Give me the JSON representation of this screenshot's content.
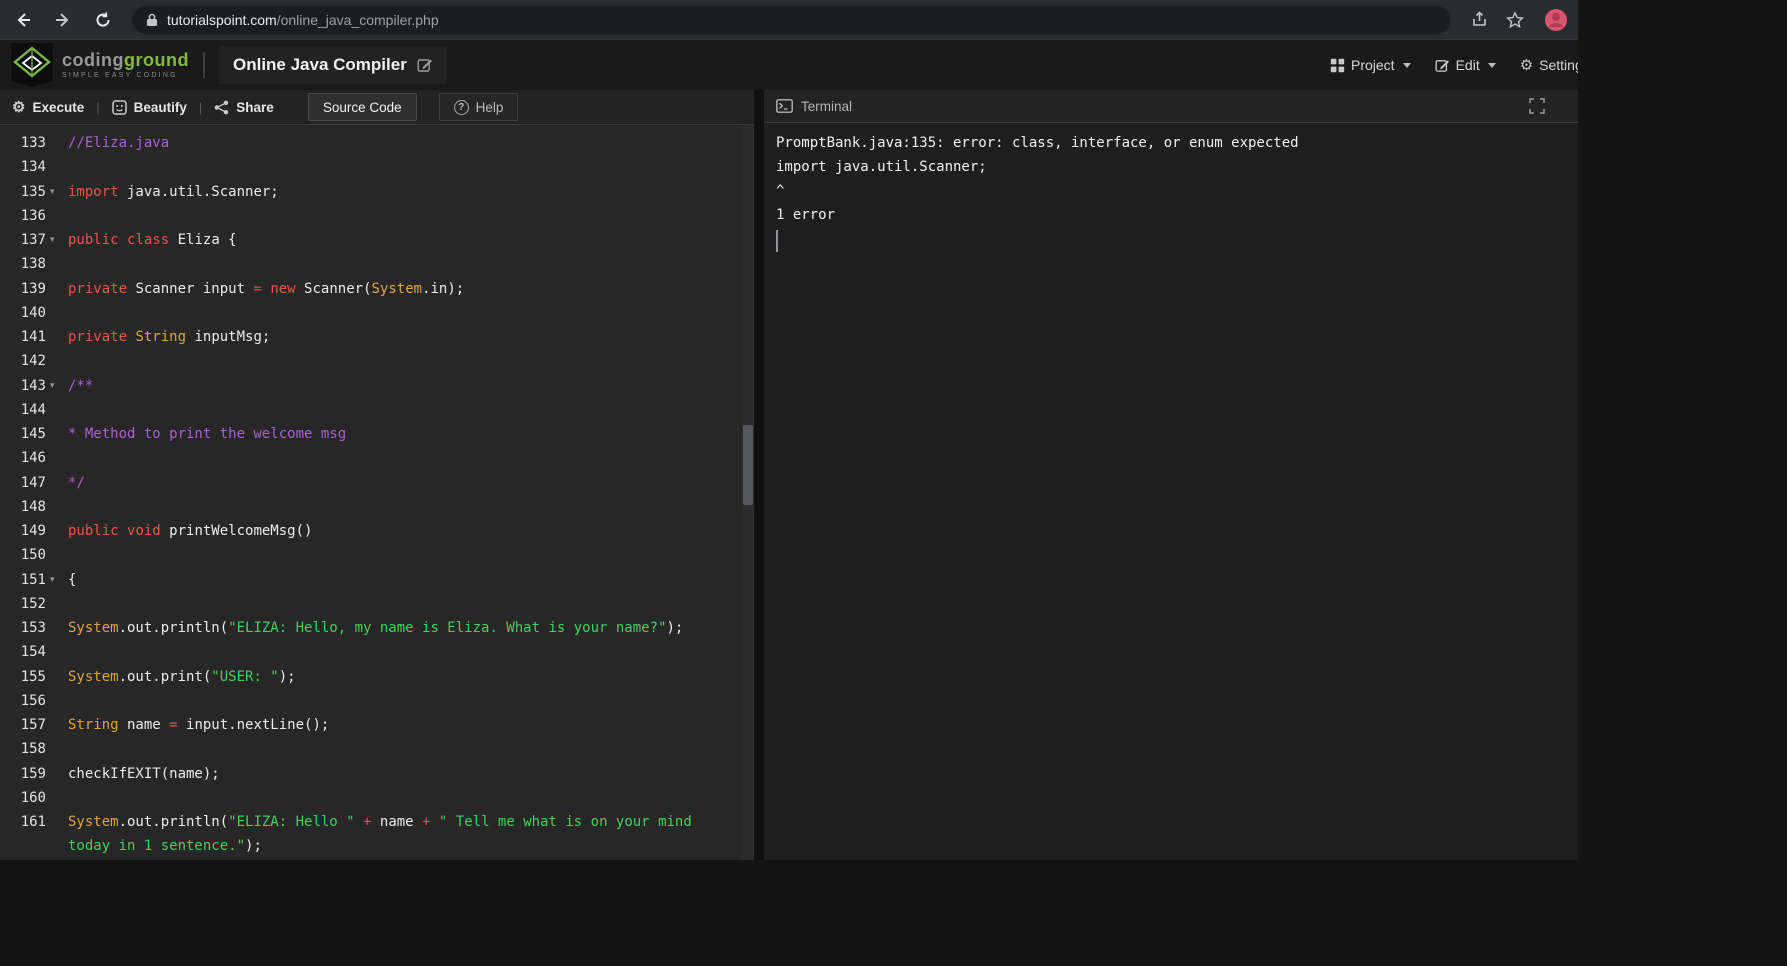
{
  "browser": {
    "url_host": "tutorialspoint.com",
    "url_path": "/online_java_compiler.php"
  },
  "header": {
    "brand_part1": "coding",
    "brand_part2": "ground",
    "tagline": "SIMPLE EASY CODING",
    "title": "Online Java Compiler",
    "menus": {
      "project": "Project",
      "edit": "Edit",
      "settings": "Settings"
    }
  },
  "toolbar": {
    "execute": "Execute",
    "beautify": "Beautify",
    "share": "Share",
    "divider": "|",
    "tabs": {
      "source": "Source Code",
      "help": "Help"
    }
  },
  "icons": {
    "gear": "⚙",
    "help": "?",
    "fold_caret": "▾"
  },
  "editor": {
    "lines": [
      {
        "n": "133",
        "fold": false,
        "seg": [
          [
            "c",
            "//Eliza.java"
          ]
        ]
      },
      {
        "n": "134",
        "fold": false,
        "seg": []
      },
      {
        "n": "135",
        "fold": true,
        "seg": [
          [
            "k",
            "import"
          ],
          [
            "p",
            " java.util.Scanner;"
          ]
        ]
      },
      {
        "n": "136",
        "fold": false,
        "seg": []
      },
      {
        "n": "137",
        "fold": true,
        "seg": [
          [
            "k",
            "public"
          ],
          [
            "p",
            " "
          ],
          [
            "k",
            "class"
          ],
          [
            "p",
            " Eliza {"
          ]
        ]
      },
      {
        "n": "138",
        "fold": false,
        "seg": []
      },
      {
        "n": "139",
        "fold": false,
        "seg": [
          [
            "k",
            "private"
          ],
          [
            "p",
            " Scanner input "
          ],
          [
            "o",
            "="
          ],
          [
            "p",
            " "
          ],
          [
            "k",
            "new"
          ],
          [
            "p",
            " Scanner("
          ],
          [
            "t",
            "System"
          ],
          [
            "p",
            ".in);"
          ]
        ]
      },
      {
        "n": "140",
        "fold": false,
        "seg": []
      },
      {
        "n": "141",
        "fold": false,
        "seg": [
          [
            "k",
            "private"
          ],
          [
            "p",
            " "
          ],
          [
            "t",
            "String"
          ],
          [
            "p",
            " inputMsg;"
          ]
        ]
      },
      {
        "n": "142",
        "fold": false,
        "seg": []
      },
      {
        "n": "143",
        "fold": true,
        "seg": [
          [
            "c",
            "/**"
          ]
        ]
      },
      {
        "n": "144",
        "fold": false,
        "seg": []
      },
      {
        "n": "145",
        "fold": false,
        "seg": [
          [
            "c",
            "* Method to print the welcome msg"
          ]
        ]
      },
      {
        "n": "146",
        "fold": false,
        "seg": []
      },
      {
        "n": "147",
        "fold": false,
        "seg": [
          [
            "c",
            "*/"
          ]
        ]
      },
      {
        "n": "148",
        "fold": false,
        "seg": []
      },
      {
        "n": "149",
        "fold": false,
        "seg": [
          [
            "k",
            "public"
          ],
          [
            "p",
            " "
          ],
          [
            "k",
            "void"
          ],
          [
            "p",
            " printWelcomeMsg()"
          ]
        ]
      },
      {
        "n": "150",
        "fold": false,
        "seg": []
      },
      {
        "n": "151",
        "fold": true,
        "seg": [
          [
            "p",
            "{"
          ]
        ]
      },
      {
        "n": "152",
        "fold": false,
        "seg": []
      },
      {
        "n": "153",
        "fold": false,
        "seg": [
          [
            "t",
            "System"
          ],
          [
            "p",
            ".out.println("
          ],
          [
            "s",
            "\"ELIZA: Hello, my name is Eliza. What is your name?\""
          ],
          [
            "p",
            ");"
          ]
        ]
      },
      {
        "n": "154",
        "fold": false,
        "seg": []
      },
      {
        "n": "155",
        "fold": false,
        "seg": [
          [
            "t",
            "System"
          ],
          [
            "p",
            ".out.print("
          ],
          [
            "s",
            "\"USER: \""
          ],
          [
            "p",
            ");"
          ]
        ]
      },
      {
        "n": "156",
        "fold": false,
        "seg": []
      },
      {
        "n": "157",
        "fold": false,
        "seg": [
          [
            "t",
            "String"
          ],
          [
            "p",
            " name "
          ],
          [
            "o",
            "="
          ],
          [
            "p",
            " input.nextLine();"
          ]
        ]
      },
      {
        "n": "158",
        "fold": false,
        "seg": []
      },
      {
        "n": "159",
        "fold": false,
        "seg": [
          [
            "p",
            "checkIfEXIT(name);"
          ]
        ]
      },
      {
        "n": "160",
        "fold": false,
        "seg": []
      },
      {
        "n": "161",
        "fold": false,
        "seg": [
          [
            "t",
            "System"
          ],
          [
            "p",
            ".out.println("
          ],
          [
            "s",
            "\"ELIZA: Hello \""
          ],
          [
            "p",
            " "
          ],
          [
            "o",
            "+"
          ],
          [
            "p",
            " name "
          ],
          [
            "o",
            "+"
          ],
          [
            "p",
            " "
          ],
          [
            "s",
            "\" Tell me what is on your mind"
          ]
        ],
        "wrap": [
          [
            "s",
            "today in 1 sentence.\""
          ],
          [
            "p",
            ");"
          ]
        ]
      }
    ]
  },
  "terminal": {
    "title": "Terminal",
    "lines": [
      "PromptBank.java:135: error: class, interface, or enum expected",
      "import java.util.Scanner;",
      "^",
      "1 error"
    ]
  },
  "colors": {
    "keyword": "#e8564a",
    "type": "#e0a33c",
    "string": "#42d15c",
    "comment": "#ae5fd8",
    "operator": "#f2455c",
    "accent_green": "#84b840"
  }
}
